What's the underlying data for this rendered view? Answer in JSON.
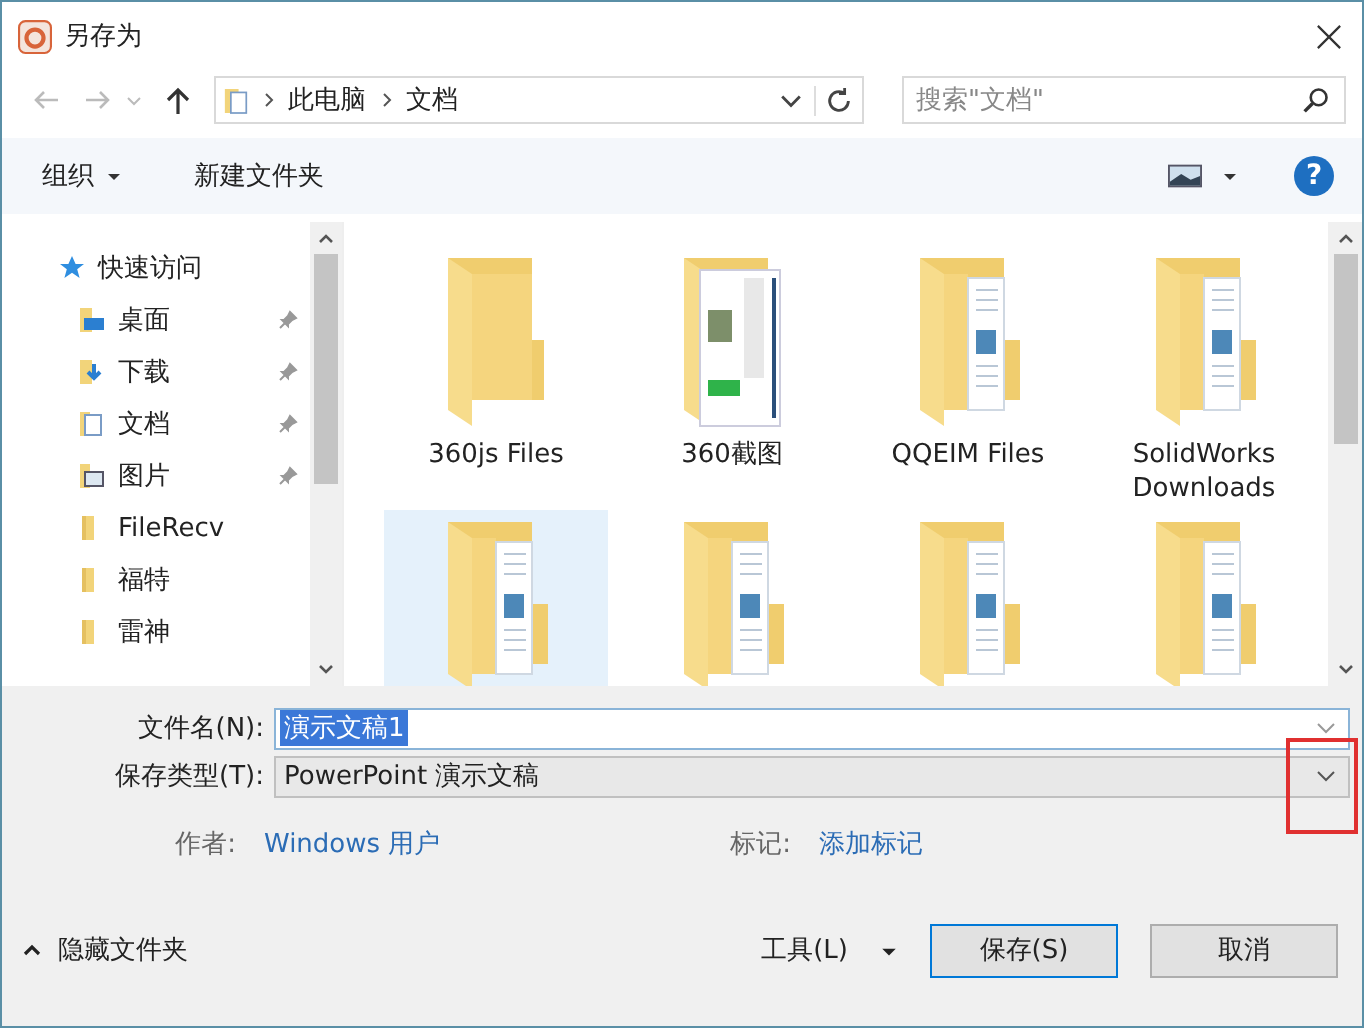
{
  "window": {
    "title": "另存为"
  },
  "nav": {
    "path": [
      "此电脑",
      "文档"
    ],
    "search": {
      "placeholder": "搜索\"文档\""
    }
  },
  "toolbar": {
    "organize": "组织",
    "new_folder": "新建文件夹",
    "help": "?"
  },
  "sidebar": {
    "items": [
      {
        "label": "快速访问",
        "kind": "star",
        "pinned": false,
        "children": [
          {
            "label": "桌面",
            "kind": "desktop",
            "pinned": true
          },
          {
            "label": "下载",
            "kind": "download",
            "pinned": true
          },
          {
            "label": "文档",
            "kind": "document",
            "pinned": true
          },
          {
            "label": "图片",
            "kind": "picture",
            "pinned": true
          },
          {
            "label": "FileRecv",
            "kind": "folder",
            "pinned": false
          },
          {
            "label": "福特",
            "kind": "folder",
            "pinned": false
          },
          {
            "label": "雷神",
            "kind": "folder",
            "pinned": false
          }
        ]
      }
    ]
  },
  "folders": [
    {
      "label": "360js Files",
      "kind": "plain",
      "selected": false
    },
    {
      "label": "360截图",
      "kind": "screenshot",
      "selected": false
    },
    {
      "label": "QQEIM Files",
      "kind": "docs",
      "selected": false
    },
    {
      "label": "SolidWorks Downloads",
      "kind": "docs",
      "selected": false
    },
    {
      "kind": "docs",
      "selected": true
    },
    {
      "kind": "docs",
      "selected": false
    },
    {
      "kind": "docs",
      "selected": false
    },
    {
      "kind": "docs",
      "selected": false
    }
  ],
  "form": {
    "filename": {
      "label": "文件名(N):",
      "value": "演示文稿1",
      "selected": true
    },
    "save_type": {
      "label": "保存类型(T):",
      "value": "PowerPoint 演示文稿"
    },
    "author": {
      "label": "作者:",
      "value": "Windows 用户"
    },
    "tags": {
      "label": "标记:",
      "value": "添加标记"
    }
  },
  "footer": {
    "hide_folders": "隐藏文件夹",
    "tools": "工具(L)",
    "buttons": [
      "保存(S)",
      "取消"
    ]
  }
}
